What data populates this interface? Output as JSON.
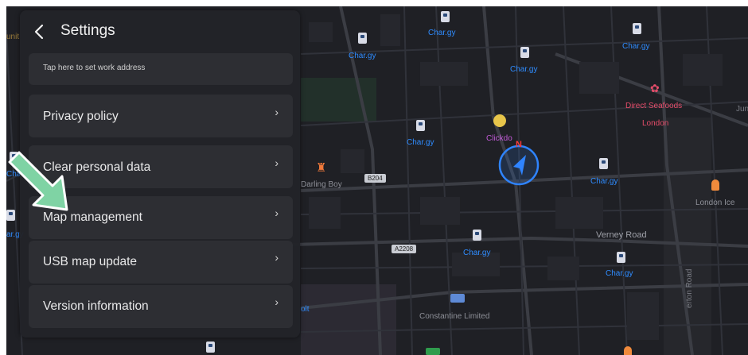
{
  "settings": {
    "title": "Settings",
    "items": [
      {
        "label": "Tap here to set work address"
      },
      {
        "label": "Privacy policy",
        "chevron": "›"
      },
      {
        "label": "Clear personal data",
        "chevron": "›"
      },
      {
        "label": "Map management",
        "chevron": "›"
      },
      {
        "label": "USB map update",
        "chevron": "›"
      },
      {
        "label": "Version information",
        "chevron": "›"
      }
    ]
  },
  "map": {
    "labels": {
      "charger": "Char.gy",
      "restaurant": "Direct Seafoods",
      "restaurant_city": "London",
      "clickdo": "Clickdo",
      "darling": "Darling Boy",
      "london_ice": "London Ice",
      "verney": "Verney Road",
      "constantine": "Constantine Limited",
      "road_b204": "B204",
      "road_a2208": "A2208",
      "unit": "unit",
      "jun": "Jun",
      "olt": "olt",
      "cha": "Cha",
      "ar_gy": "ar.gy",
      "erton": "erton Road"
    },
    "compass_north": "N",
    "colors": {
      "charger_text": "#2f8cff",
      "restaurant": "#e64d6a",
      "clickdo": "#c15ad6",
      "location_ring": "#2f84ff"
    }
  }
}
